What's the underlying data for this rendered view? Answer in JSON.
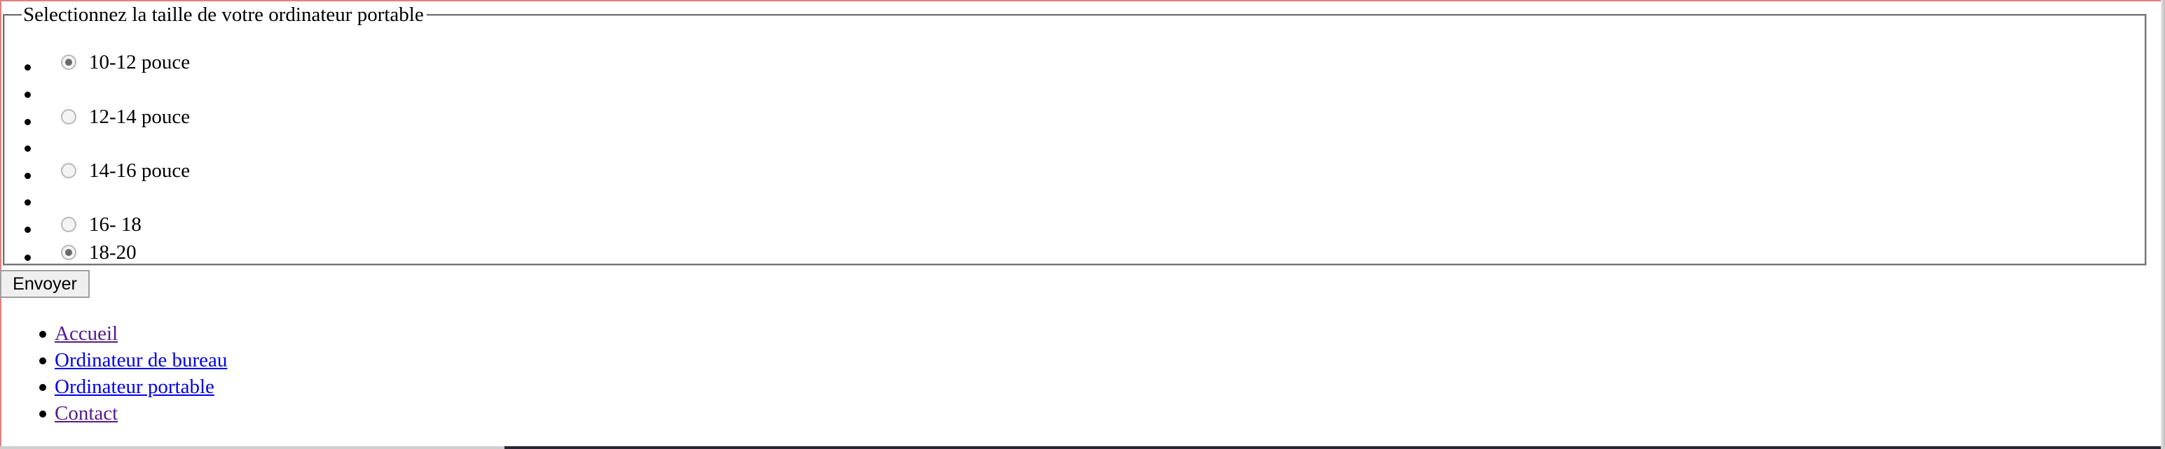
{
  "form": {
    "legend": "Selectionnez la taille de votre ordinateur portable",
    "options": [
      {
        "label": "10-12 pouce",
        "checked": true
      },
      {
        "label": "12-14 pouce",
        "checked": false
      },
      {
        "label": "14-16 pouce",
        "checked": false
      },
      {
        "label": "16- 18",
        "checked": false
      },
      {
        "label": "18-20",
        "checked": true
      }
    ],
    "submit_label": "Envoyer"
  },
  "nav": {
    "items": [
      {
        "label": "Accueil",
        "state": "visited"
      },
      {
        "label": "Ordinateur de bureau",
        "state": "link"
      },
      {
        "label": "Ordinateur portable",
        "state": "link"
      },
      {
        "label": "Contact",
        "state": "visited"
      }
    ]
  },
  "colors": {
    "link": "#0000ee",
    "visited_link": "#551a8b",
    "frame_border": "#e08080"
  }
}
